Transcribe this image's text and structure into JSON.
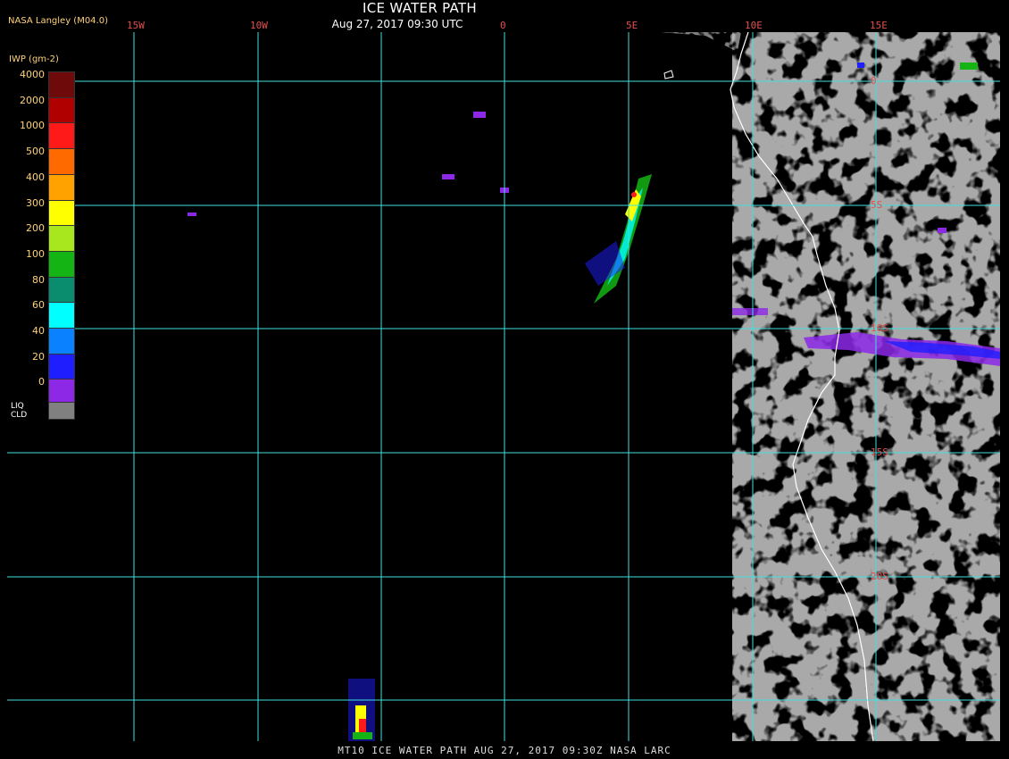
{
  "header": {
    "title": "ICE WATER PATH",
    "datetime": "Aug 27, 2017 09:30 UTC",
    "brand": "NASA Langley (M04.0)"
  },
  "footer": {
    "text": "MT10  ICE WATER PATH   AUG 27, 2017 09:30Z   NASA LARC"
  },
  "grid": {
    "lon_labels": [
      "15W",
      "10W",
      "0",
      "5E",
      "10E",
      "15E"
    ],
    "lat_labels": [
      "0",
      "5S",
      "10S",
      "15S",
      "20S"
    ]
  },
  "legend": {
    "unit": "IWP (gm-2)",
    "entries": [
      {
        "label": "4000",
        "color": "#6e0a0a"
      },
      {
        "label": "2000",
        "color": "#b00000"
      },
      {
        "label": "1000",
        "color": "#ff1a1a"
      },
      {
        "label": "500",
        "color": "#ff6a00"
      },
      {
        "label": "400",
        "color": "#ffa200"
      },
      {
        "label": "300",
        "color": "#ffff00"
      },
      {
        "label": "200",
        "color": "#a8e61e"
      },
      {
        "label": "100",
        "color": "#14b414"
      },
      {
        "label": "80",
        "color": "#0a8c6e"
      },
      {
        "label": "60",
        "color": "#00ffff"
      },
      {
        "label": "40",
        "color": "#0a82ff"
      },
      {
        "label": "20",
        "color": "#1e1eff"
      },
      {
        "label": "0",
        "color": "#8c28e6"
      }
    ],
    "liq_label_top": "LIQ",
    "liq_label_bottom": "CLD",
    "liq_color": "#808080"
  },
  "colors": {
    "background": "#000000",
    "liquid_cloud": "#808080",
    "grid": "#40e0e0",
    "coastline": "#ffffff",
    "label": "#e05050"
  }
}
